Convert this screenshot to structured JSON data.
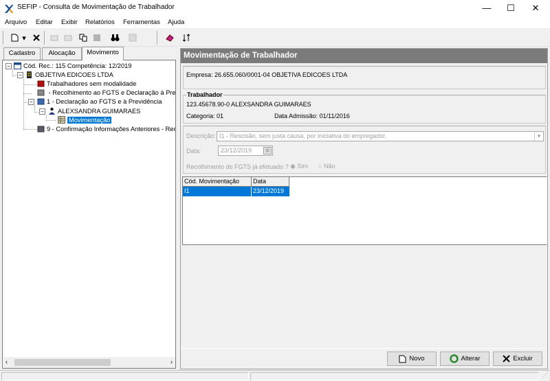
{
  "window": {
    "title": "SEFIP - Consulta de Movimentação de Trabalhador",
    "minimize": "—",
    "maximize": "☐",
    "close": "✕"
  },
  "menu": [
    "Arquivo",
    "Editar",
    "Exibir",
    "Relatórios",
    "Ferramentas",
    "Ajuda"
  ],
  "tabs": [
    "Cadastro",
    "Alocação",
    "Movimento"
  ],
  "tree": {
    "root": "Cód. Rec.: 115 Competência: 12/2019",
    "company": "OBJETIVA EDICOES LTDA",
    "no_modality": "Trabalhadores sem modalidade",
    "modality_blank": " - Recolhimento ao FGTS e Declaração à Pre",
    "modality_1": "1 - Declaração ao FGTS e à Previdência",
    "worker": "ALEXSANDRA GUIMARAES",
    "movement": "Movimentação",
    "modality_9": "9 - Confirmação Informações Anteriores - Rec/"
  },
  "panel": {
    "header": "Movimentação de Trabalhador",
    "empresa": "Empresa: 26.655.060/0001-04  OBJETIVA EDICOES LTDA",
    "worker_group_title": "Trabalhador",
    "worker_line": "123.45678.90-0  ALEXSANDRA GUIMARAES",
    "categoria": "Categoria: 01",
    "data_admissao": "Data Admissão: 01/11/2016",
    "descricao_label": "Descrição:",
    "descricao_value": "I1 - Rescisão, sem justa causa, por iniciativa do empregador.",
    "data_label": "Data:",
    "data_value": "23/12/2019",
    "recolhimento_label": "Recolhimento do FGTS já efetuado ?",
    "sim": "Sim",
    "nao": "Não"
  },
  "grid": {
    "columns": [
      "Cód. Movimentação",
      "Data"
    ],
    "rows": [
      [
        "I1",
        "23/12/2019"
      ]
    ]
  },
  "buttons": {
    "novo": "Novo",
    "alterar": "Alterar",
    "excluir": "Excluir"
  },
  "colors": {
    "selection": "#0078d7",
    "header_bg": "#7b7b7b"
  }
}
